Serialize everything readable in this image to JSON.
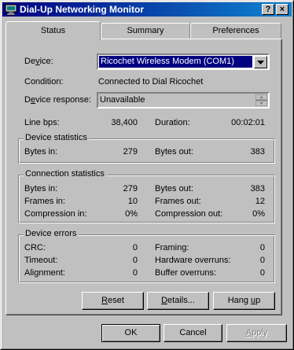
{
  "window": {
    "title": "Dial-Up Networking Monitor",
    "help_button": "?",
    "close_button": "×"
  },
  "tabs": [
    {
      "label": "Status",
      "active": true
    },
    {
      "label": "Summary",
      "active": false
    },
    {
      "label": "Preferences",
      "active": false
    }
  ],
  "status": {
    "device_label_pre": "De",
    "device_label_ul": "v",
    "device_label_post": "ice:",
    "device_value": "Ricochet Wireless Modem (COM1)",
    "condition_label": "Condition:",
    "condition_value": "Connected to Dial Ricochet",
    "device_response_label_pre": "D",
    "device_response_label_ul": "e",
    "device_response_label_post": "vice response:",
    "device_response_value": "Unavailable",
    "line_bps_label": "Line bps:",
    "line_bps_value": "38,400",
    "duration_label": "Duration:",
    "duration_value": "00:02:01"
  },
  "device_statistics": {
    "title": "Device statistics",
    "bytes_in_label": "Bytes in:",
    "bytes_in_value": "279",
    "bytes_out_label": "Bytes out:",
    "bytes_out_value": "383"
  },
  "connection_statistics": {
    "title": "Connection statistics",
    "bytes_in_label": "Bytes in:",
    "bytes_in_value": "279",
    "bytes_out_label": "Bytes out:",
    "bytes_out_value": "383",
    "frames_in_label": "Frames in:",
    "frames_in_value": "10",
    "frames_out_label": "Frames out:",
    "frames_out_value": "12",
    "compression_in_label": "Compression in:",
    "compression_in_value": "0%",
    "compression_out_label": "Compression out:",
    "compression_out_value": "0%"
  },
  "device_errors": {
    "title": "Device errors",
    "crc_label": "CRC:",
    "crc_value": "0",
    "timeout_label": "Timeout:",
    "timeout_value": "0",
    "alignment_label": "Alignment:",
    "alignment_value": "0",
    "framing_label": "Framing:",
    "framing_value": "0",
    "hw_overruns_label": "Hardware overruns:",
    "hw_overruns_value": "0",
    "buffer_overruns_label": "Buffer overruns:",
    "buffer_overruns_value": "0"
  },
  "panel_buttons": {
    "reset_ul": "R",
    "reset_rest": "eset",
    "details_ul": "D",
    "details_rest": "etails...",
    "hangup_pre": "Hang ",
    "hangup_ul": "u",
    "hangup_post": "p"
  },
  "dialog_buttons": {
    "ok": "OK",
    "cancel": "Cancel",
    "apply_ul": "A",
    "apply_rest": "pply"
  },
  "colors": {
    "titlebar_start": "#000080",
    "titlebar_end": "#1084d0",
    "face": "#c0c0c0",
    "selection": "#000080"
  },
  "icons": {
    "title": "dial-up-monitor-icon",
    "combo_arrow": "triangle-down-icon",
    "spinner": "spinner-icon"
  }
}
